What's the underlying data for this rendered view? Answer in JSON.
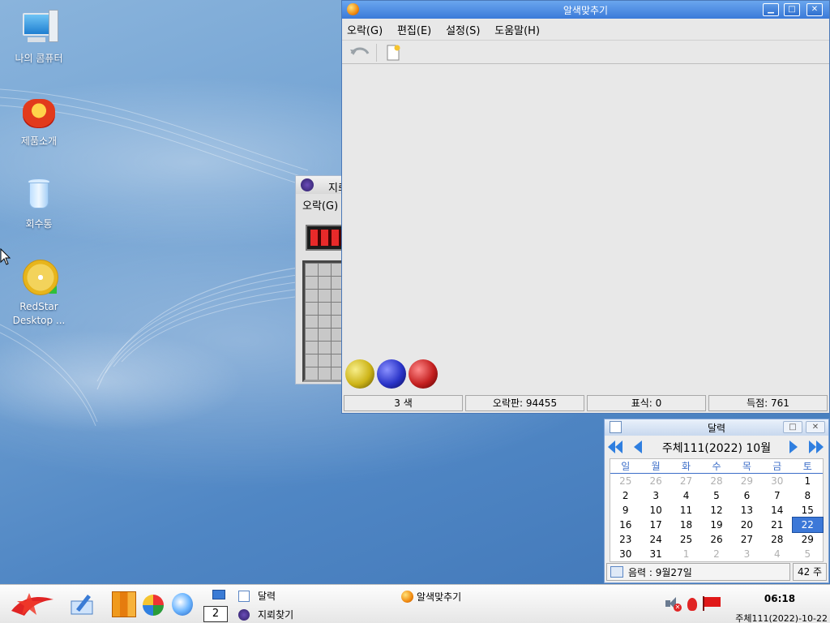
{
  "desktop": {
    "icons": [
      {
        "label": "나의 콤퓨터",
        "icon": "computer-icon"
      },
      {
        "label": "제품소개",
        "icon": "product-intro-icon"
      },
      {
        "label": "회수통",
        "icon": "trash-icon"
      },
      {
        "label": "RedStar Desktop ...",
        "icon": "cd-icon"
      }
    ]
  },
  "game_window": {
    "title": "알색맞추기",
    "menu": [
      "오락(G)",
      "편집(E)",
      "설정(S)",
      "도움말(H)"
    ],
    "status": [
      "3 색",
      "오락판:  94455",
      "표식:      0",
      "득점:    761"
    ],
    "balls": [
      "#d6c21d",
      "#2a34c8",
      "#c42020"
    ]
  },
  "mine_window": {
    "title": "지뢰찾기",
    "menu": "오락(G)"
  },
  "calendar": {
    "title": "달력",
    "month_label": "주체111(2022)  10월",
    "weekdays": [
      "일",
      "월",
      "화",
      "수",
      "목",
      "금",
      "토"
    ],
    "weeks": [
      [
        "25",
        "26",
        "27",
        "28",
        "29",
        "30",
        "1"
      ],
      [
        "2",
        "3",
        "4",
        "5",
        "6",
        "7",
        "8"
      ],
      [
        "9",
        "10",
        "11",
        "12",
        "13",
        "14",
        "15"
      ],
      [
        "16",
        "17",
        "18",
        "19",
        "20",
        "21",
        "22"
      ],
      [
        "23",
        "24",
        "25",
        "26",
        "27",
        "28",
        "29"
      ],
      [
        "30",
        "31",
        "1",
        "2",
        "3",
        "4",
        "5"
      ]
    ],
    "lunar": "음력 : 9월27일",
    "week_no": "42 주"
  },
  "taskbar": {
    "workspace": "2",
    "tasks": [
      "달력",
      "지뢰찾기",
      "알색맞추기"
    ],
    "time": "06:18",
    "date": "주체111(2022)-10-22"
  }
}
